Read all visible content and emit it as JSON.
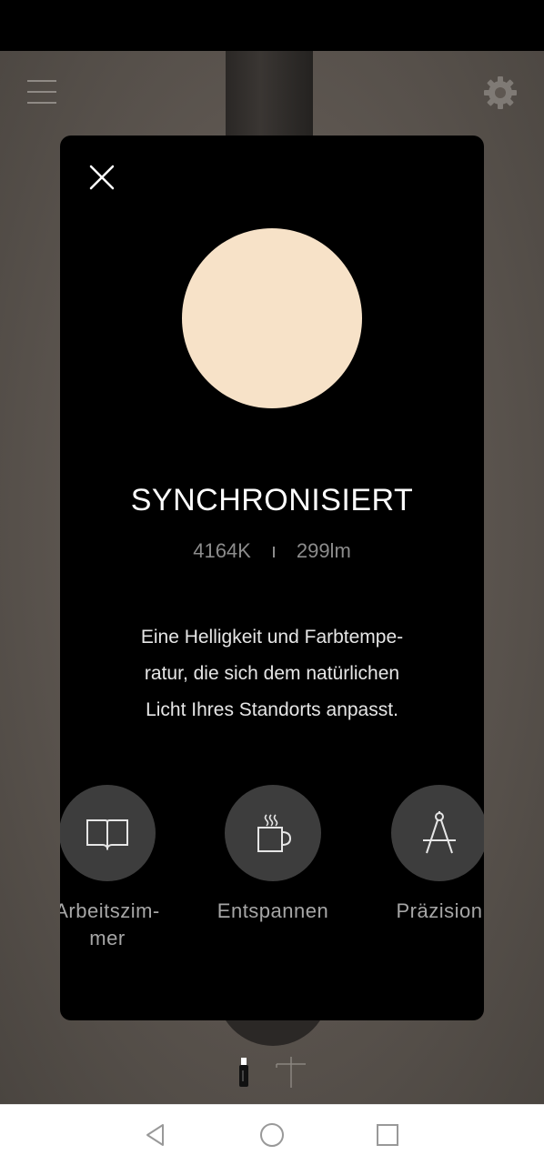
{
  "colors": {
    "light_preview": "#f7e2c8",
    "preset_circle": "#3d3d3d",
    "modal_bg": "#000000"
  },
  "modal": {
    "title": "SYNCHRONISIERT",
    "color_temperature": "4164K",
    "brightness": "299lm",
    "description_line1": "Eine Helligkeit und Farbtempe-",
    "description_line2": "ratur, die sich dem natürlichen",
    "description_line3": "Licht Ihres Standorts anpasst.",
    "presets": [
      {
        "label_line1": "Arbeitszim-",
        "label_line2": "mer",
        "icon": "book-icon"
      },
      {
        "label_line1": "Entspannen",
        "label_line2": "",
        "icon": "coffee-cup-icon"
      },
      {
        "label_line1": "Präzision",
        "label_line2": "",
        "icon": "compass-icon"
      }
    ]
  },
  "icons": {
    "menu": "hamburger-menu-icon",
    "settings": "gear-icon",
    "close": "close-icon",
    "nav_back": "back-triangle-icon",
    "nav_home": "home-circle-icon",
    "nav_recents": "recents-square-icon"
  }
}
